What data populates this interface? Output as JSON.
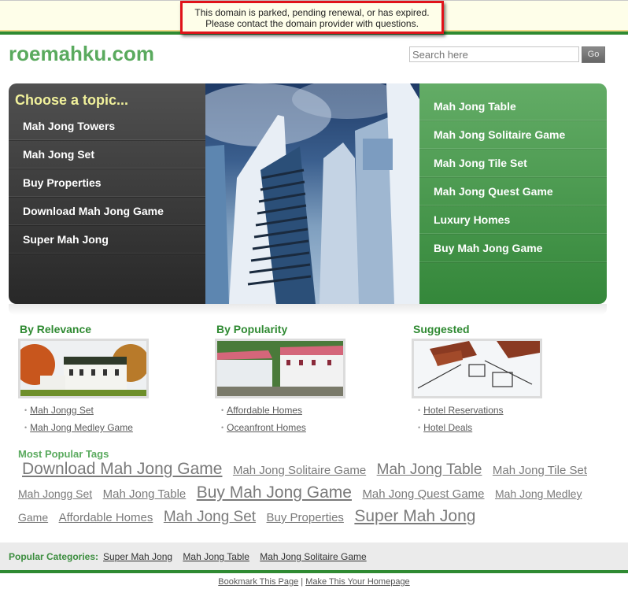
{
  "notice": {
    "line1": "This domain is parked, pending renewal, or has expired.",
    "line2": "Please contact the domain provider with questions."
  },
  "header": {
    "site_title": "roemahku.com",
    "search_placeholder": "Search here",
    "search_button": "Go"
  },
  "hero": {
    "heading": "Choose a topic...",
    "left_items": [
      {
        "label": "Mah Jong Towers"
      },
      {
        "label": "Mah Jong Set"
      },
      {
        "label": "Buy Properties"
      },
      {
        "label": "Download Mah Jong Game"
      },
      {
        "label": "Super Mah Jong"
      }
    ],
    "right_items": [
      {
        "label": "Mah Jong Table"
      },
      {
        "label": "Mah Jong Solitaire Game"
      },
      {
        "label": "Mah Jong Tile Set"
      },
      {
        "label": "Mah Jong Quest Game"
      },
      {
        "label": "Luxury Homes"
      },
      {
        "label": "Buy Mah Jong Game"
      }
    ]
  },
  "columns": [
    {
      "title": "By Relevance",
      "image": "house-autumn-image",
      "links": [
        "Mah Jongg Set",
        "Mah Jong Medley Game"
      ]
    },
    {
      "title": "By Popularity",
      "image": "house-red-roof-image",
      "links": [
        "Affordable Homes",
        "Oceanfront Homes"
      ]
    },
    {
      "title": "Suggested",
      "image": "blueprint-roofs-image",
      "links": [
        "Hotel Reservations",
        "Hotel Deals"
      ]
    }
  ],
  "tags": {
    "title": "Most Popular Tags",
    "items": [
      {
        "label": "Download Mah Jong Game",
        "size": "t1"
      },
      {
        "label": "Mah Jong Solitaire Game",
        "size": "t2"
      },
      {
        "label": "Mah Jong Table",
        "size": "t3"
      },
      {
        "label": "Mah Jong Tile Set",
        "size": "t2"
      },
      {
        "label": "Mah Jongg Set",
        "size": "t4"
      },
      {
        "label": "Mah Jong Table",
        "size": "t2"
      },
      {
        "label": "Buy Mah Jong Game",
        "size": "t1"
      },
      {
        "label": "Mah Jong Quest Game",
        "size": "t2"
      },
      {
        "label": "Mah Jong Medley Game",
        "size": "t4"
      },
      {
        "label": "Affordable Homes",
        "size": "t2"
      },
      {
        "label": "Mah Jong Set",
        "size": "t3"
      },
      {
        "label": "Buy Properties",
        "size": "t2"
      },
      {
        "label": "Super Mah Jong",
        "size": "t1"
      }
    ]
  },
  "popular_categories": {
    "label": "Popular Categories:",
    "links": [
      "Super Mah Jong",
      "Mah Jong Table",
      "Mah Jong Solitaire Game"
    ]
  },
  "footer": {
    "bookmark": "Bookmark This Page",
    "separator": "|",
    "homepage": "Make This Your Homepage"
  }
}
